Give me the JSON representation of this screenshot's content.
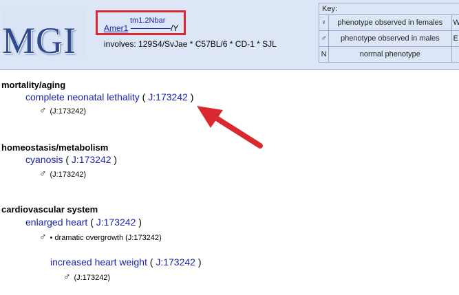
{
  "header": {
    "logo_text": "MGI",
    "genotype": {
      "gene": "Amer1",
      "allele_superscript": "tm1.2Nbar",
      "suffix": "/Y",
      "involves": "involves: 129S4/SvJae * C57BL/6 * CD-1 * SJL"
    },
    "key": {
      "title": "Key:",
      "rows": [
        {
          "symbol": "♀",
          "description": "phenotype observed in females",
          "extra": "W"
        },
        {
          "symbol": "♂",
          "description": "phenotype observed in males",
          "extra": "E"
        },
        {
          "symbol": "N",
          "description": "normal phenotype",
          "extra": ""
        }
      ]
    }
  },
  "sections": [
    {
      "heading": "mortality/aging",
      "term": "complete neonatal lethality",
      "ref": "J:173242",
      "open": "(",
      "close": ")",
      "note_symbol": "♂",
      "note": "(J:173242)"
    },
    {
      "heading": "homeostasis/metabolism",
      "term": "cyanosis",
      "ref": "J:173242",
      "open": "(",
      "close": ")",
      "note_symbol": "♂",
      "note": "(J:173242)"
    },
    {
      "heading": "cardiovascular system",
      "term": "enlarged heart",
      "ref": "J:173242",
      "open": "(",
      "close": ")",
      "note_symbol": "♂",
      "note": "• dramatic overgrowth (J:173242)",
      "subterm": {
        "term": "increased heart weight",
        "ref": "J:173242",
        "open": "(",
        "close": ")",
        "note_symbol": "♂",
        "note": "(J:173242)"
      }
    }
  ],
  "colors": {
    "link": "#1a24a8",
    "header_bg": "#dde6f7",
    "highlight": "#d9282f"
  }
}
